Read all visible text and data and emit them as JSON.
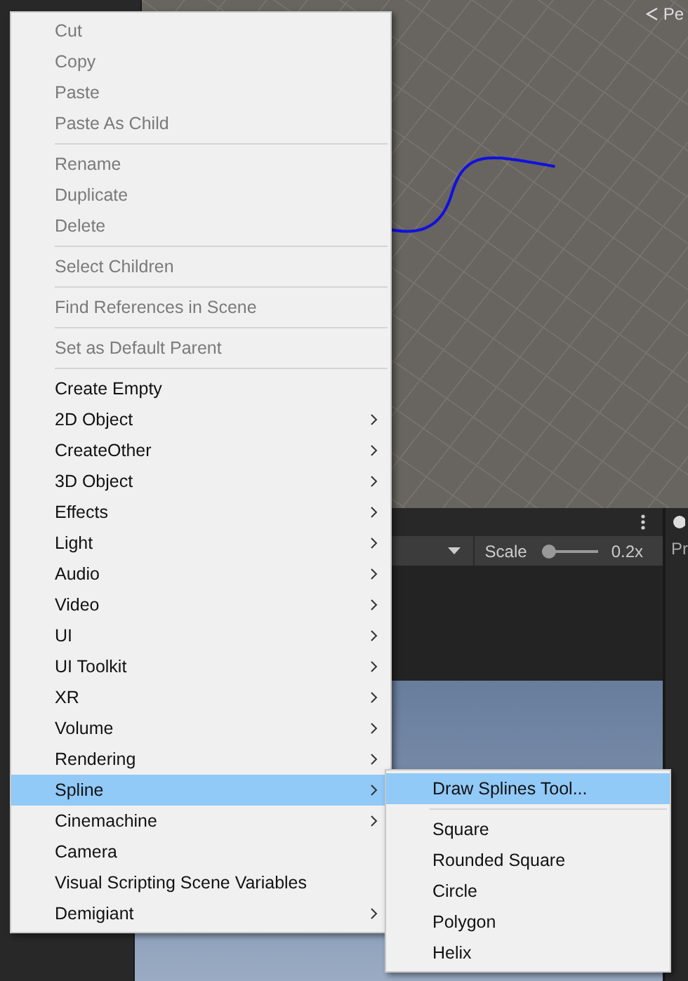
{
  "scene_view": {
    "overlay_label": "Pe"
  },
  "game_view": {
    "toolbar": {
      "scale_label": "Scale",
      "scale_slider": {
        "level": 0
      },
      "scale_reading": "0.2x"
    }
  },
  "inspector": {
    "header_label": "Pr"
  },
  "context_menu": {
    "sections": [
      [
        {
          "label": "Cut",
          "disabled": true,
          "has_submenu": false,
          "selected": false
        },
        {
          "label": "Copy",
          "disabled": true,
          "has_submenu": false,
          "selected": false
        },
        {
          "label": "Paste",
          "disabled": true,
          "has_submenu": false,
          "selected": false
        },
        {
          "label": "Paste As Child",
          "disabled": true,
          "has_submenu": false,
          "selected": false
        }
      ],
      [
        {
          "label": "Rename",
          "disabled": true,
          "has_submenu": false,
          "selected": false
        },
        {
          "label": "Duplicate",
          "disabled": true,
          "has_submenu": false,
          "selected": false
        },
        {
          "label": "Delete",
          "disabled": true,
          "has_submenu": false,
          "selected": false
        }
      ],
      [
        {
          "label": "Select Children",
          "disabled": true,
          "has_submenu": false,
          "selected": false
        }
      ],
      [
        {
          "label": "Find References in Scene",
          "disabled": true,
          "has_submenu": false,
          "selected": false
        }
      ],
      [
        {
          "label": "Set as Default Parent",
          "disabled": true,
          "has_submenu": false,
          "selected": false
        }
      ],
      [
        {
          "label": "Create Empty",
          "disabled": false,
          "has_submenu": false,
          "selected": false
        },
        {
          "label": "2D Object",
          "disabled": false,
          "has_submenu": true,
          "selected": false
        },
        {
          "label": "CreateOther",
          "disabled": false,
          "has_submenu": true,
          "selected": false
        },
        {
          "label": "3D Object",
          "disabled": false,
          "has_submenu": true,
          "selected": false
        },
        {
          "label": "Effects",
          "disabled": false,
          "has_submenu": true,
          "selected": false
        },
        {
          "label": "Light",
          "disabled": false,
          "has_submenu": true,
          "selected": false
        },
        {
          "label": "Audio",
          "disabled": false,
          "has_submenu": true,
          "selected": false
        },
        {
          "label": "Video",
          "disabled": false,
          "has_submenu": true,
          "selected": false
        },
        {
          "label": "UI",
          "disabled": false,
          "has_submenu": true,
          "selected": false
        },
        {
          "label": "UI Toolkit",
          "disabled": false,
          "has_submenu": true,
          "selected": false
        },
        {
          "label": "XR",
          "disabled": false,
          "has_submenu": true,
          "selected": false
        },
        {
          "label": "Volume",
          "disabled": false,
          "has_submenu": true,
          "selected": false
        },
        {
          "label": "Rendering",
          "disabled": false,
          "has_submenu": true,
          "selected": false
        },
        {
          "label": "Spline",
          "disabled": false,
          "has_submenu": true,
          "selected": true
        },
        {
          "label": "Cinemachine",
          "disabled": false,
          "has_submenu": true,
          "selected": false
        },
        {
          "label": "Camera",
          "disabled": false,
          "has_submenu": false,
          "selected": false
        },
        {
          "label": "Visual Scripting Scene Variables",
          "disabled": false,
          "has_submenu": false,
          "selected": false
        },
        {
          "label": "Demigiant",
          "disabled": false,
          "has_submenu": true,
          "selected": false
        }
      ]
    ]
  },
  "submenu": {
    "sections": [
      [
        {
          "label": "Draw Splines Tool...",
          "selected": true
        }
      ],
      [
        {
          "label": "Square",
          "selected": false
        },
        {
          "label": "Rounded Square",
          "selected": false
        },
        {
          "label": "Circle",
          "selected": false
        },
        {
          "label": "Polygon",
          "selected": false
        },
        {
          "label": "Helix",
          "selected": false
        }
      ]
    ]
  }
}
